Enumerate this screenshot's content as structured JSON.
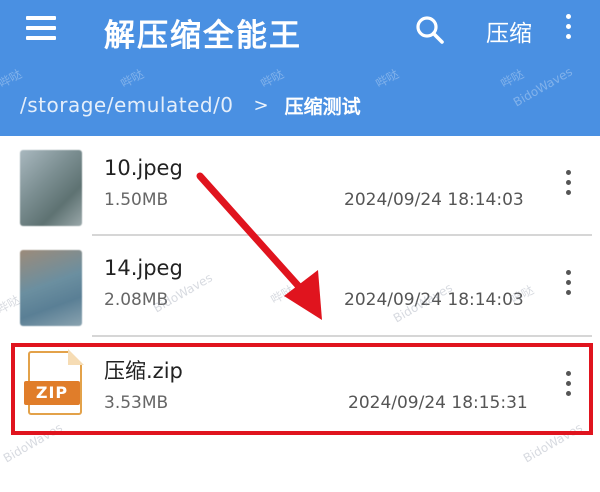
{
  "app_bar": {
    "title": "解压缩全能王",
    "compress_label": "压缩",
    "color": "#4a90e2",
    "icons": [
      "menu-icon",
      "search-icon",
      "more-vert-icon"
    ]
  },
  "breadcrumb": {
    "root": "/storage/emulated/0",
    "separator": ">",
    "current": "压缩测试"
  },
  "files": [
    {
      "name": "10.jpeg",
      "size": "1.50MB",
      "date": "2024/09/24 18:14:03",
      "type": "image"
    },
    {
      "name": "14.jpeg",
      "size": "2.08MB",
      "date": "2024/09/24 18:14:03",
      "type": "image"
    },
    {
      "name": "压缩.zip",
      "size": "3.53MB",
      "date": "2024/09/24 18:15:31",
      "type": "zip",
      "icon_label": "ZIP",
      "highlighted": true
    }
  ],
  "annotation": {
    "highlight_color": "#e0141e"
  },
  "watermark": {
    "text_cn": "哔哒",
    "text_en": "BidoWaves"
  }
}
